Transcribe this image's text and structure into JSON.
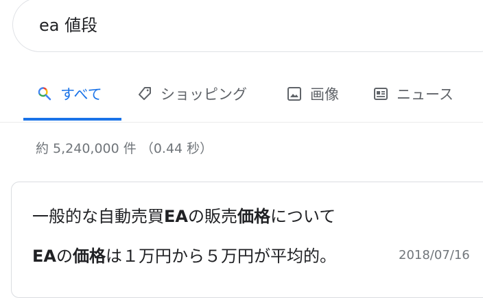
{
  "search": {
    "query": "ea 値段"
  },
  "tabs": [
    {
      "label": "すべて",
      "icon": "search-icon",
      "active": true
    },
    {
      "label": "ショッピング",
      "icon": "tag-icon",
      "active": false
    },
    {
      "label": "画像",
      "icon": "image-icon",
      "active": false
    },
    {
      "label": "ニュース",
      "icon": "news-icon",
      "active": false
    }
  ],
  "stats": {
    "text": "約 5,240,000 件 （0.44 秒）"
  },
  "snippet": {
    "title": {
      "part1": "一般的な自動売買",
      "bold1": "EA",
      "part2": "の販売",
      "bold2": "価格",
      "part3": "について"
    },
    "body": {
      "bold1": "EA",
      "part1": "の",
      "bold2": "価格",
      "part2": "は１万円から５万円が平均的。"
    },
    "date": "2018/07/16"
  },
  "colors": {
    "accent": "#1a73e8",
    "muted": "#70757a",
    "text": "#202124"
  }
}
